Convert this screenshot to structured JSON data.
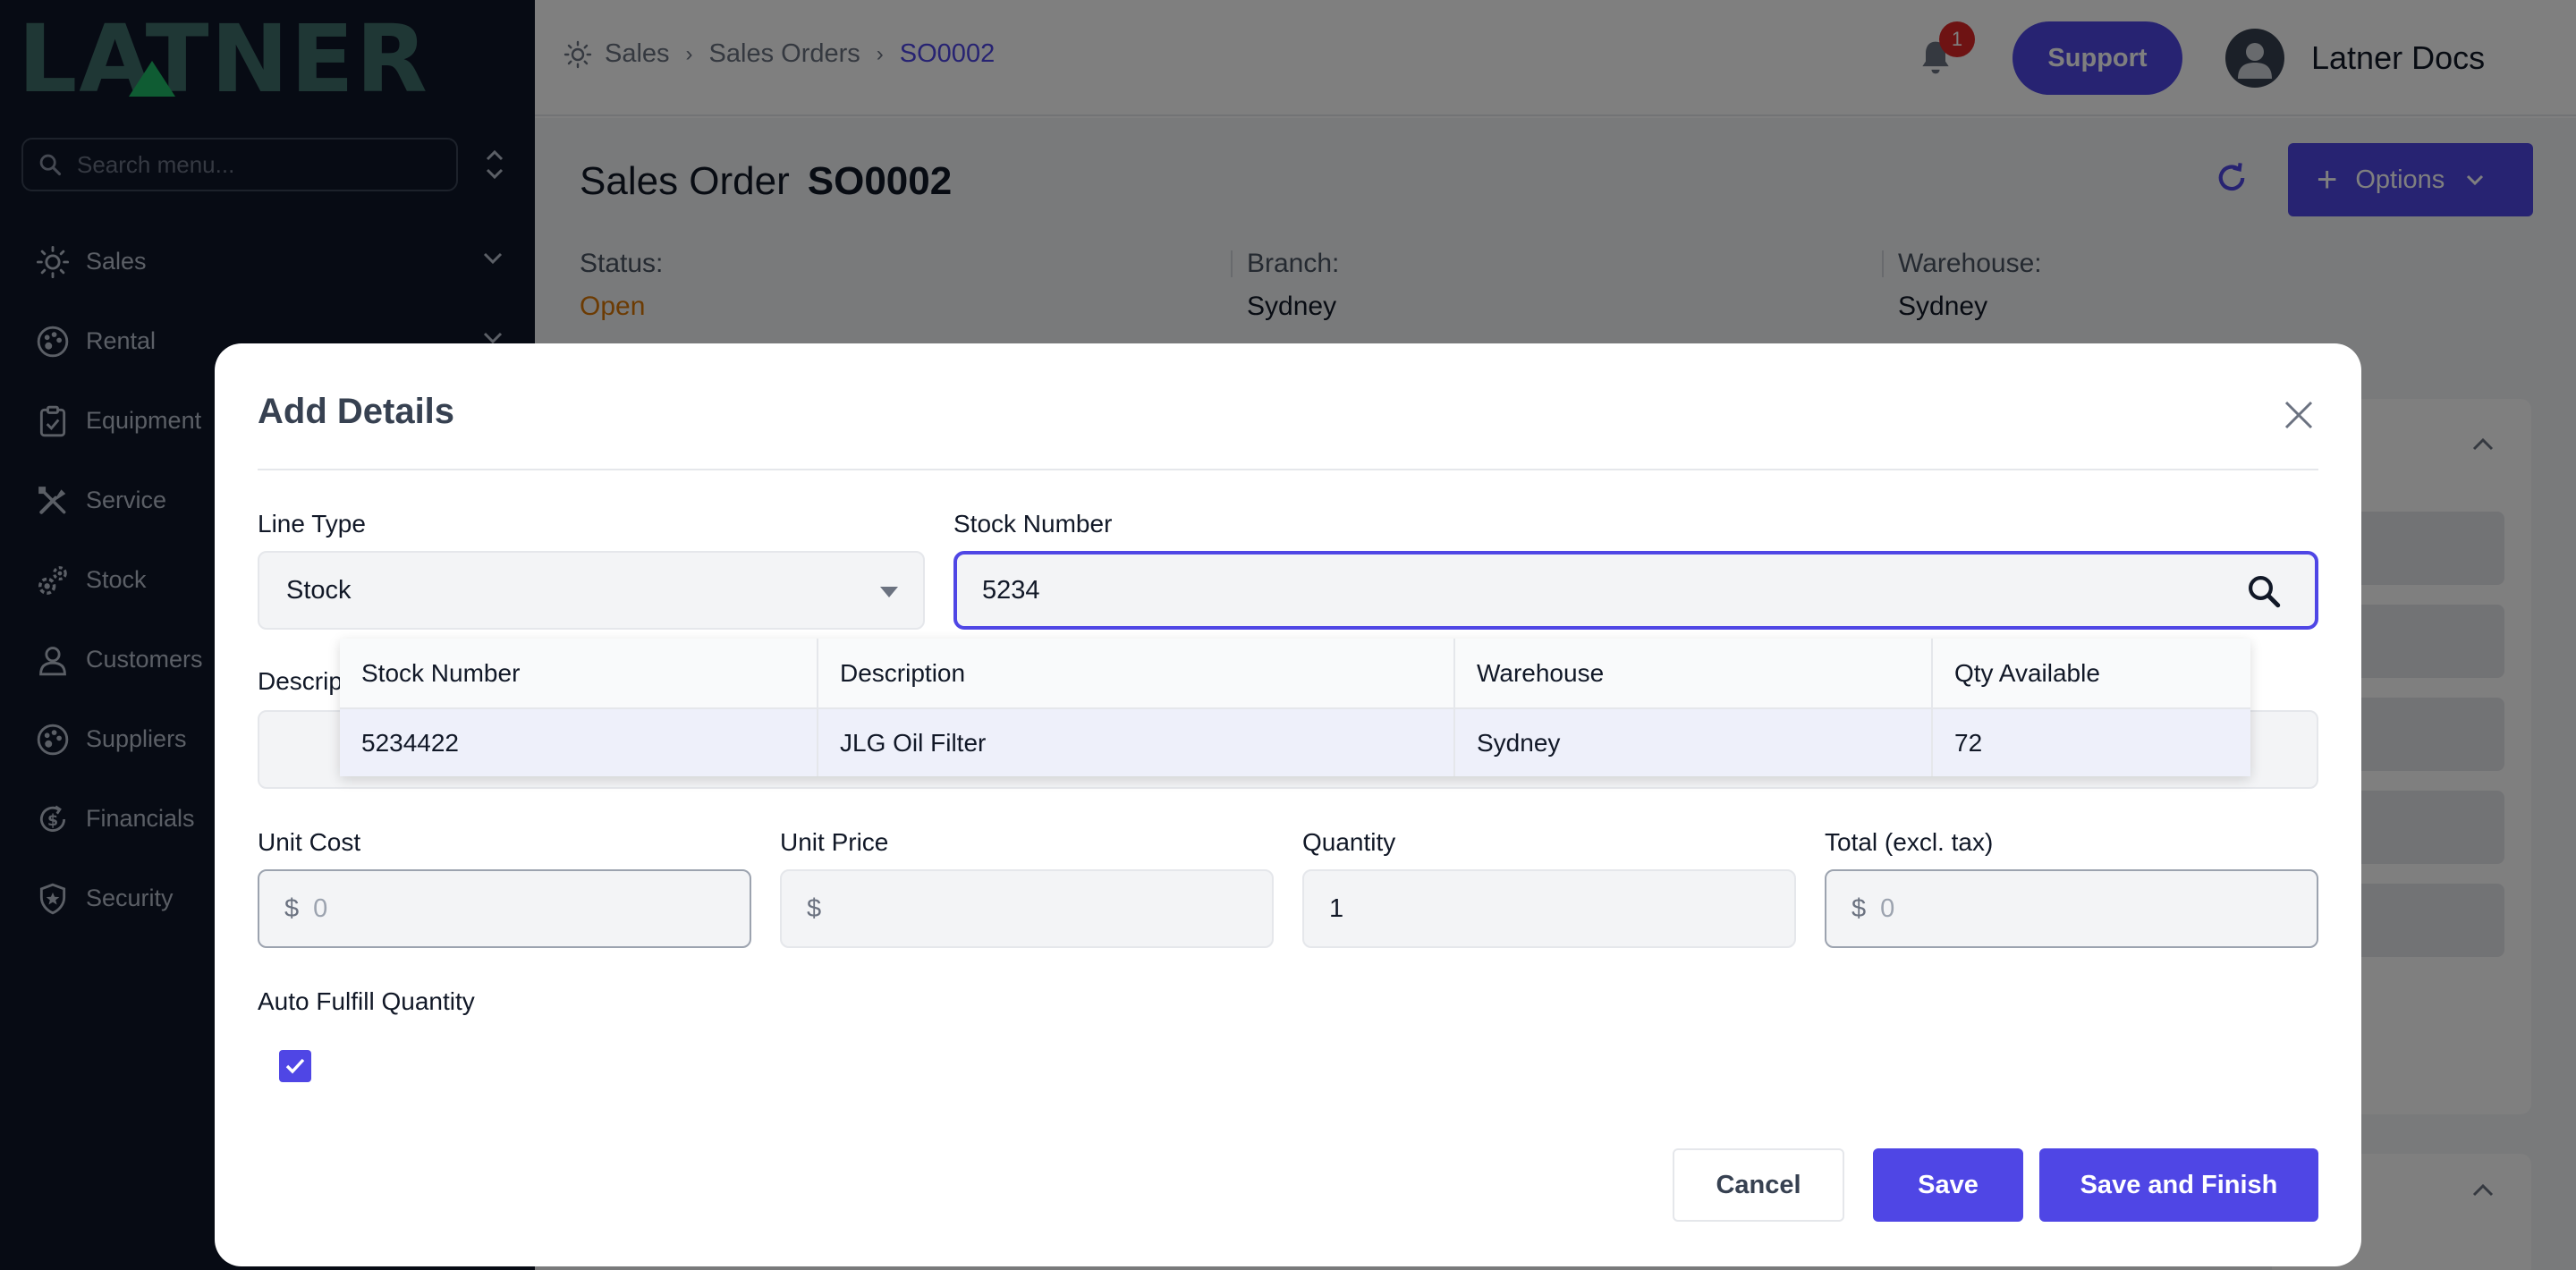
{
  "logo": {
    "text": "LATNER"
  },
  "sidebar": {
    "search_placeholder": "Search menu...",
    "items": [
      {
        "label": "Sales",
        "icon": "sun-icon",
        "expandable": true
      },
      {
        "label": "Rental",
        "icon": "palette-icon",
        "expandable": true
      },
      {
        "label": "Equipment",
        "icon": "clipboard-icon",
        "expandable": false
      },
      {
        "label": "Service",
        "icon": "tools-icon",
        "expandable": false
      },
      {
        "label": "Stock",
        "icon": "gears-icon",
        "expandable": false
      },
      {
        "label": "Customers",
        "icon": "person-icon",
        "expandable": false
      },
      {
        "label": "Suppliers",
        "icon": "palette-icon",
        "expandable": false
      },
      {
        "label": "Financials",
        "icon": "dollar-cycle-icon",
        "expandable": false
      },
      {
        "label": "Security",
        "icon": "shield-icon",
        "expandable": false
      }
    ]
  },
  "breadcrumb": [
    "Sales",
    "Sales Orders",
    "SO0002"
  ],
  "header": {
    "notification_count": "1",
    "support_label": "Support",
    "user_name": "Latner Docs"
  },
  "page": {
    "title_prefix": "Sales Order",
    "title_id": "SO0002",
    "options_label": "Options",
    "status_label": "Status:",
    "status_value": "Open",
    "branch_label": "Branch:",
    "branch_value": "Sydney",
    "warehouse_label": "Warehouse:",
    "warehouse_value": "Sydney"
  },
  "modal": {
    "title": "Add Details",
    "line_type_label": "Line Type",
    "line_type_value": "Stock",
    "stock_number_label": "Stock Number",
    "stock_number_value": "5234",
    "description_label": "Description",
    "unit_cost_label": "Unit Cost",
    "unit_cost_value": "0",
    "unit_price_label": "Unit Price",
    "unit_price_value": "",
    "quantity_label": "Quantity",
    "quantity_value": "1",
    "total_label": "Total (excl. tax)",
    "total_value": "0",
    "currency_symbol": "$",
    "auto_fulfill_label": "Auto Fulfill Quantity",
    "auto_fulfill_checked": true,
    "cancel_label": "Cancel",
    "save_label": "Save",
    "save_finish_label": "Save and Finish"
  },
  "results": {
    "columns": [
      "Stock Number",
      "Description",
      "Warehouse",
      "Qty Available"
    ],
    "rows": [
      {
        "stock_number": "5234422",
        "description": "JLG Oil Filter",
        "warehouse": "Sydney",
        "qty": "72"
      }
    ]
  },
  "colors": {
    "accent": "#4f46e5",
    "sidebar_bg": "#0f1729",
    "status_open": "#d97706",
    "badge": "#dc2626"
  }
}
